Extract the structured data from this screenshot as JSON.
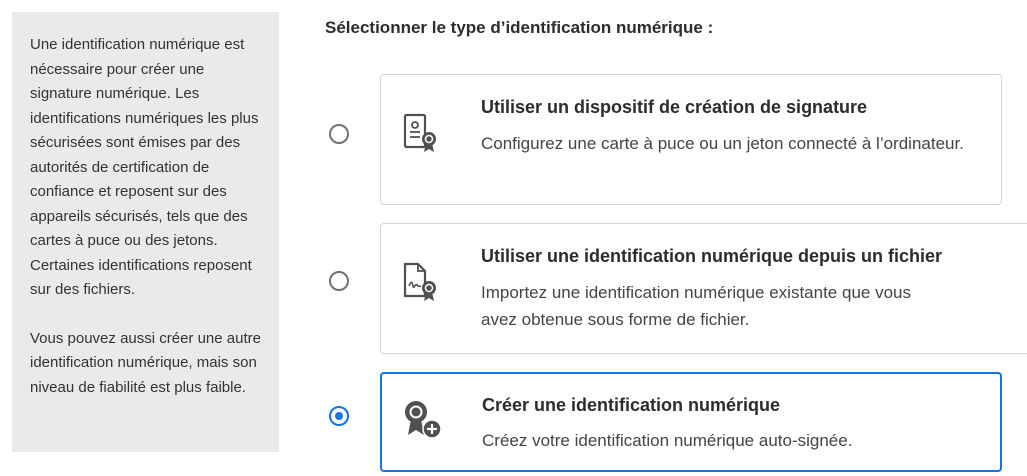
{
  "info": {
    "paragraph1": "Une identification numérique est nécessaire pour créer une signature numérique. Les identifications numériques les plus sécurisées sont émises par des autorités de certification de confiance et reposent sur des appareils sécurisés, tels que des cartes à puce ou des jetons. Certaines identifications reposent sur des fichiers.",
    "paragraph2": "Vous pouvez aussi créer une autre identification numérique, mais son niveau de fiabilité est plus faible."
  },
  "heading": "Sélectionner le type d’identification numérique :",
  "options": [
    {
      "title": "Utiliser un dispositif de création de signature",
      "description": "Configurez une carte à puce ou un jeton connecté à l’ordinateur.",
      "icon": "signature-device-icon",
      "selected": false
    },
    {
      "title": "Utiliser une identification numérique depuis un fichier",
      "description": "Importez une identification numérique existante que vous avez obtenue sous forme de fichier.",
      "icon": "file-certificate-icon",
      "selected": false
    },
    {
      "title": "Créer une identification numérique",
      "description": "Créez votre identification numérique auto-signée.",
      "icon": "create-certificate-icon",
      "selected": true
    }
  ],
  "colors": {
    "accent": "#1473e6",
    "panel_bg": "#eaeaea",
    "card_border": "#d4d4d4",
    "icon": "#505050"
  }
}
